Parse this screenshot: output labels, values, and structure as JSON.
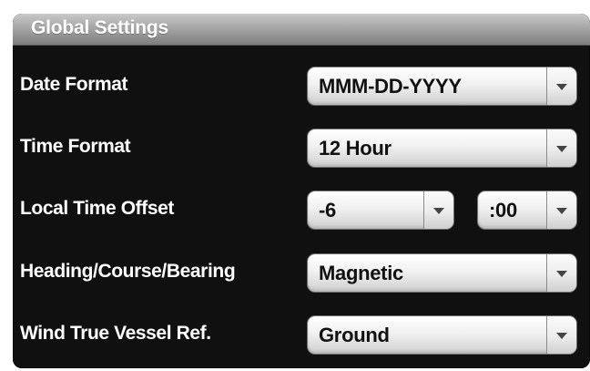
{
  "panel": {
    "title": "Global Settings"
  },
  "settings": [
    {
      "label": "Date Format",
      "value": "MMM-DD-YYYY"
    },
    {
      "label": "Time Format",
      "value": "12 Hour"
    },
    {
      "label": "Local Time Offset",
      "hours": "-6",
      "minutes": ":00"
    },
    {
      "label": "Heading/Course/Bearing",
      "value": "Magnetic"
    },
    {
      "label": "Wind True Vessel Ref.",
      "value": "Ground"
    }
  ],
  "icons": {
    "dropdown": "chevron-down-icon"
  },
  "colors": {
    "panel_background": "#101010",
    "header_gradient_top": "#c9c9c9",
    "header_gradient_bottom": "#7e7e7e",
    "label_text": "#ffffff",
    "select_text": "#111111"
  }
}
